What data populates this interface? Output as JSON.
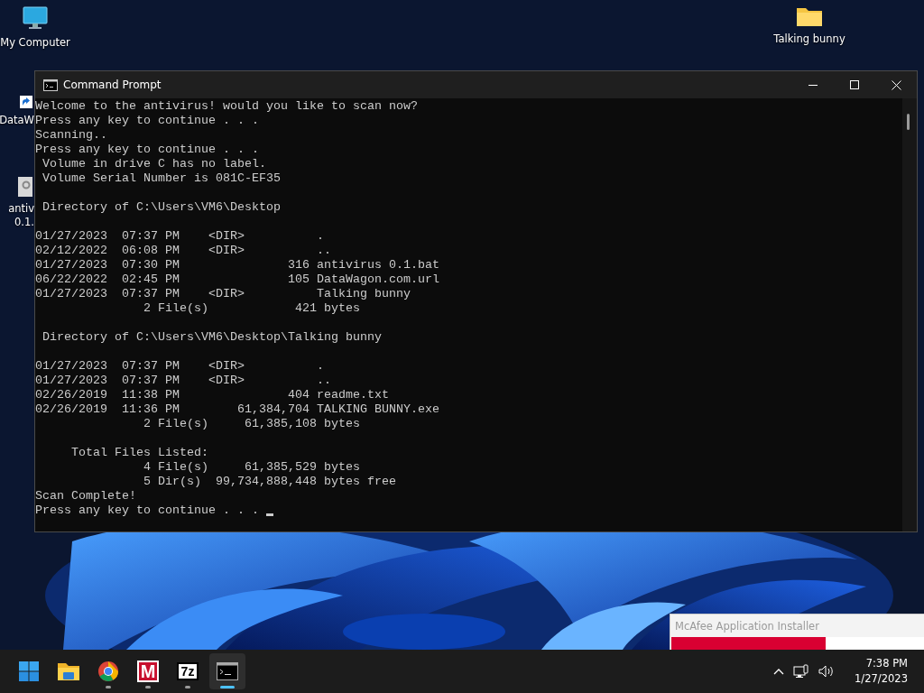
{
  "desktop": {
    "icons": [
      {
        "kind": "computer",
        "lines": [
          "My Computer"
        ]
      },
      {
        "kind": "shortcut",
        "lines": [
          "DataW"
        ]
      },
      {
        "kind": "batch",
        "lines": [
          "antiv",
          "0.1."
        ]
      },
      {
        "kind": "folder",
        "lines": [
          "Talking bunny"
        ]
      }
    ]
  },
  "window": {
    "title": "Command Prompt",
    "console": {
      "blocks": [
        [
          "Welcome to the antivirus! would you like to scan now?",
          "Press any key to continue . . .",
          "Scanning..",
          "Press any key to continue . . .",
          " Volume in drive C has no label.",
          " Volume Serial Number is 081C-EF35"
        ],
        [
          " Directory of C:\\Users\\VM6\\Desktop"
        ],
        [
          "01/27/2023  07:37 PM    <DIR>          .",
          "02/12/2022  06:08 PM    <DIR>          ..",
          "01/27/2023  07:30 PM               316 antivirus 0.1.bat",
          "06/22/2022  02:45 PM               105 DataWagon.com.url",
          "01/27/2023  07:37 PM    <DIR>          Talking bunny",
          "               2 File(s)            421 bytes"
        ],
        [
          " Directory of C:\\Users\\VM6\\Desktop\\Talking bunny"
        ],
        [
          "01/27/2023  07:37 PM    <DIR>          .",
          "01/27/2023  07:37 PM    <DIR>          ..",
          "02/26/2019  11:38 PM               404 readme.txt",
          "02/26/2019  11:36 PM        61,384,704 TALKING BUNNY.exe",
          "               2 File(s)     61,385,108 bytes"
        ],
        [
          "     Total Files Listed:",
          "               4 File(s)     61,385,529 bytes",
          "               5 Dir(s)  99,734,888,448 bytes free",
          "Scan Complete!",
          "Press any key to continue . . . "
        ]
      ]
    }
  },
  "installer_popup": {
    "title": "McAfee Application Installer",
    "level": 0.59
  },
  "taskbar": {
    "apps": [
      {
        "kind": "start",
        "running": false,
        "selected": false
      },
      {
        "kind": "explorer",
        "running": false,
        "selected": false
      },
      {
        "kind": "chrome",
        "running": true,
        "selected": false
      },
      {
        "kind": "mcafee",
        "label": "M",
        "running": true,
        "selected": false
      },
      {
        "kind": "archiver",
        "label": "7z",
        "running": true,
        "selected": false
      },
      {
        "kind": "terminal",
        "running": true,
        "selected": true
      }
    ],
    "clock": {
      "time": "7:38 PM",
      "date": "1/27/2023"
    }
  }
}
